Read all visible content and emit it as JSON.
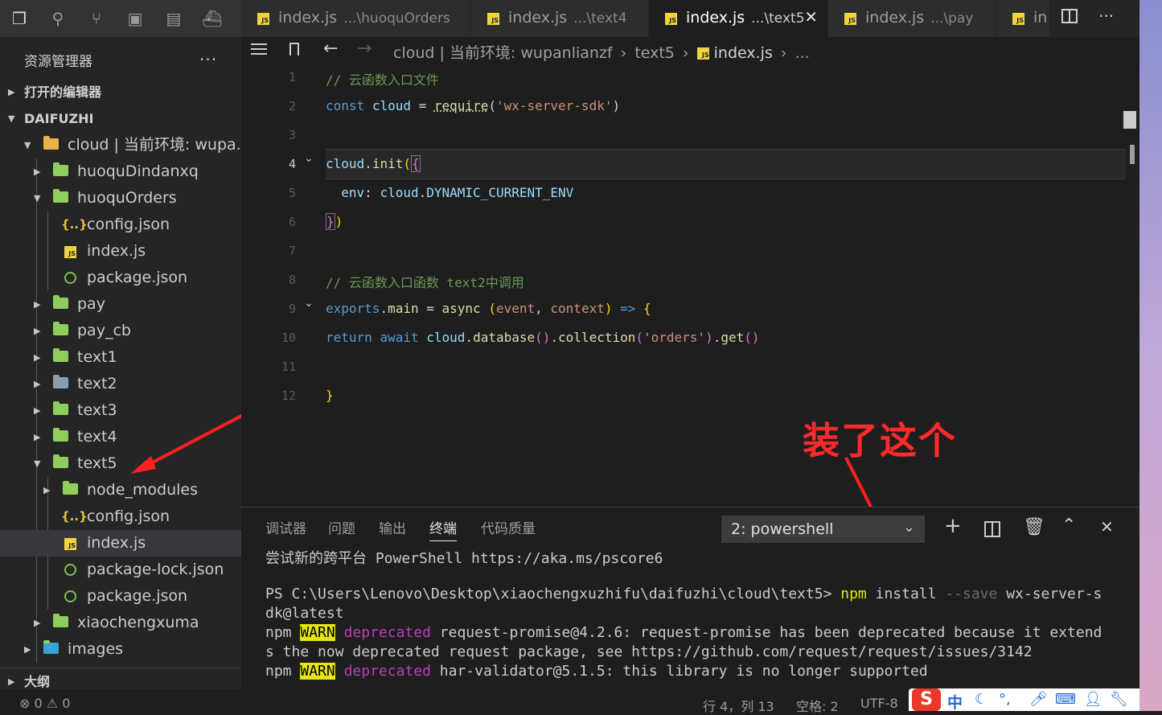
{
  "sidebar": {
    "title": "资源管理器",
    "more": "...",
    "open_editors": "打开的编辑器",
    "workspace": "DAIFUZHI",
    "outline": "大纲",
    "tree": [
      {
        "label": "cloud | 当前环境: wupa...",
        "kind": "folder-root",
        "expanded": true
      },
      {
        "label": "huoquDindanxq",
        "kind": "folder"
      },
      {
        "label": "huoquOrders",
        "kind": "folder",
        "expanded": true
      },
      {
        "label": "config.json",
        "kind": "json"
      },
      {
        "label": "index.js",
        "kind": "js"
      },
      {
        "label": "package.json",
        "kind": "pkg"
      },
      {
        "label": "pay",
        "kind": "folder"
      },
      {
        "label": "pay_cb",
        "kind": "folder"
      },
      {
        "label": "text1",
        "kind": "folder"
      },
      {
        "label": "text2",
        "kind": "folder-grey"
      },
      {
        "label": "text3",
        "kind": "folder"
      },
      {
        "label": "text4",
        "kind": "folder"
      },
      {
        "label": "text5",
        "kind": "folder",
        "expanded": true
      },
      {
        "label": "node_modules",
        "kind": "folder"
      },
      {
        "label": "config.json",
        "kind": "json"
      },
      {
        "label": "index.js",
        "kind": "js",
        "selected": true
      },
      {
        "label": "package-lock.json",
        "kind": "pkg"
      },
      {
        "label": "package.json",
        "kind": "pkg"
      },
      {
        "label": "xiaochengxuma",
        "kind": "folder"
      },
      {
        "label": "images",
        "kind": "folder-images"
      }
    ]
  },
  "tabs": [
    {
      "name": "index.js",
      "path": "...\\huoquOrders"
    },
    {
      "name": "index.js",
      "path": "...\\text4"
    },
    {
      "name": "index.js",
      "path": "...\\text5",
      "active": true,
      "close": "✕"
    },
    {
      "name": "index.js",
      "path": "...\\pay"
    },
    {
      "name": "in",
      "path": ""
    }
  ],
  "tab_more": "···",
  "breadcrumb": {
    "seg1": "cloud | 当前环境: wupanlianzf",
    "seg2": "text5",
    "seg3": "index.js",
    "seg4": "..."
  },
  "editor": {
    "line_numbers": [
      "1",
      "2",
      "3",
      "4",
      "5",
      "6",
      "7",
      "8",
      "9",
      "10",
      "11",
      "12"
    ],
    "current_line": "4"
  },
  "panel": {
    "tabs": [
      "调试器",
      "问题",
      "输出",
      "终端",
      "代码质量"
    ],
    "active_tab": "终端",
    "terminal_select": "2: powershell",
    "lines": {
      "l1": "尝试新的跨平台 PowerShell https://aka.ms/pscore6",
      "prompt": "PS C:\\Users\\Lenovo\\Desktop\\xiaochengxuzhifu\\daifuzhi\\cloud\\text5>",
      "cmd_npm": "npm",
      "cmd_install": "install",
      "cmd_flag": "--save",
      "cmd_pkg": "wx-server-s",
      "cmd_pkg2": "dk@latest",
      "w1_npm": "npm",
      "warn": "WARN",
      "deprecated": "deprecated",
      "w1_text": "request-promise@4.2.6: request-promise has been deprecated because it extend",
      "w1_text2": "s the now deprecated request package, see https://github.com/request/request/issues/3142",
      "w2_text": "har-validator@5.1.5: this library is no longer supported"
    }
  },
  "annotation": "装了这个",
  "status": {
    "errors": "⊗ 0 ⚠ 0",
    "position": "行 4，列 13",
    "spaces": "空格: 2",
    "encoding": "UTF-8"
  },
  "ime": {
    "zh": "中"
  }
}
